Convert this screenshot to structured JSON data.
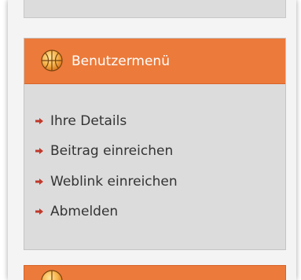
{
  "user_menu": {
    "title": "Benutzermenü",
    "icon": "basketball-icon",
    "items": [
      {
        "label": "Ihre Details"
      },
      {
        "label": "Beitrag einreichen"
      },
      {
        "label": "Weblink einreichen"
      },
      {
        "label": "Abmelden"
      }
    ]
  },
  "colors": {
    "header_orange": "#ec7a3a",
    "module_gray": "#dcdcdc",
    "arrow_red": "#c0392b",
    "text": "#333333"
  }
}
